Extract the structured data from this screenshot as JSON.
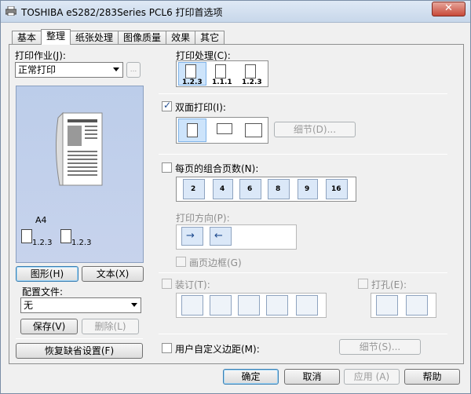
{
  "window": {
    "title": "TOSHIBA eS282/283Series PCL6 打印首选项",
    "close": "✕"
  },
  "tabs": [
    "基本",
    "整理",
    "纸张处理",
    "图像质量",
    "效果",
    "其它"
  ],
  "left": {
    "print_job_label": "打印作业(J):",
    "print_job_value": "正常打印",
    "more_button": "...",
    "paper_size": "A4",
    "collate_a": "1.2.3",
    "collate_b": "1.2.3",
    "graphic_button": "图形(H)",
    "text_button": "文本(X)",
    "profile_label": "配置文件:",
    "profile_value": "无",
    "save_button": "保存(V)",
    "delete_button": "删除(L)",
    "restore_button": "恢复缺省设置(F)"
  },
  "right": {
    "print_handling_label": "打印处理(C):",
    "handling_options": [
      "1.2.3",
      "1.1.1",
      "1.2.3"
    ],
    "duplex_label": "双面打印(I):",
    "duplex_checked": true,
    "details_button": "细节(D)...",
    "nup_label": "每页的组合页数(N):",
    "nup_checked": false,
    "nup_options": [
      "2",
      "4",
      "6",
      "8",
      "9",
      "16"
    ],
    "orientation_label": "打印方向(P):",
    "border_label": "画页边框(G)",
    "staple_label": "装订(T):",
    "punch_label": "打孔(E):",
    "margin_label": "用户自定义边距(M):",
    "margin_details_button": "细节(S)..."
  },
  "bottom": {
    "ok": "确定",
    "cancel": "取消",
    "apply": "应用 (A)",
    "help": "帮助"
  }
}
